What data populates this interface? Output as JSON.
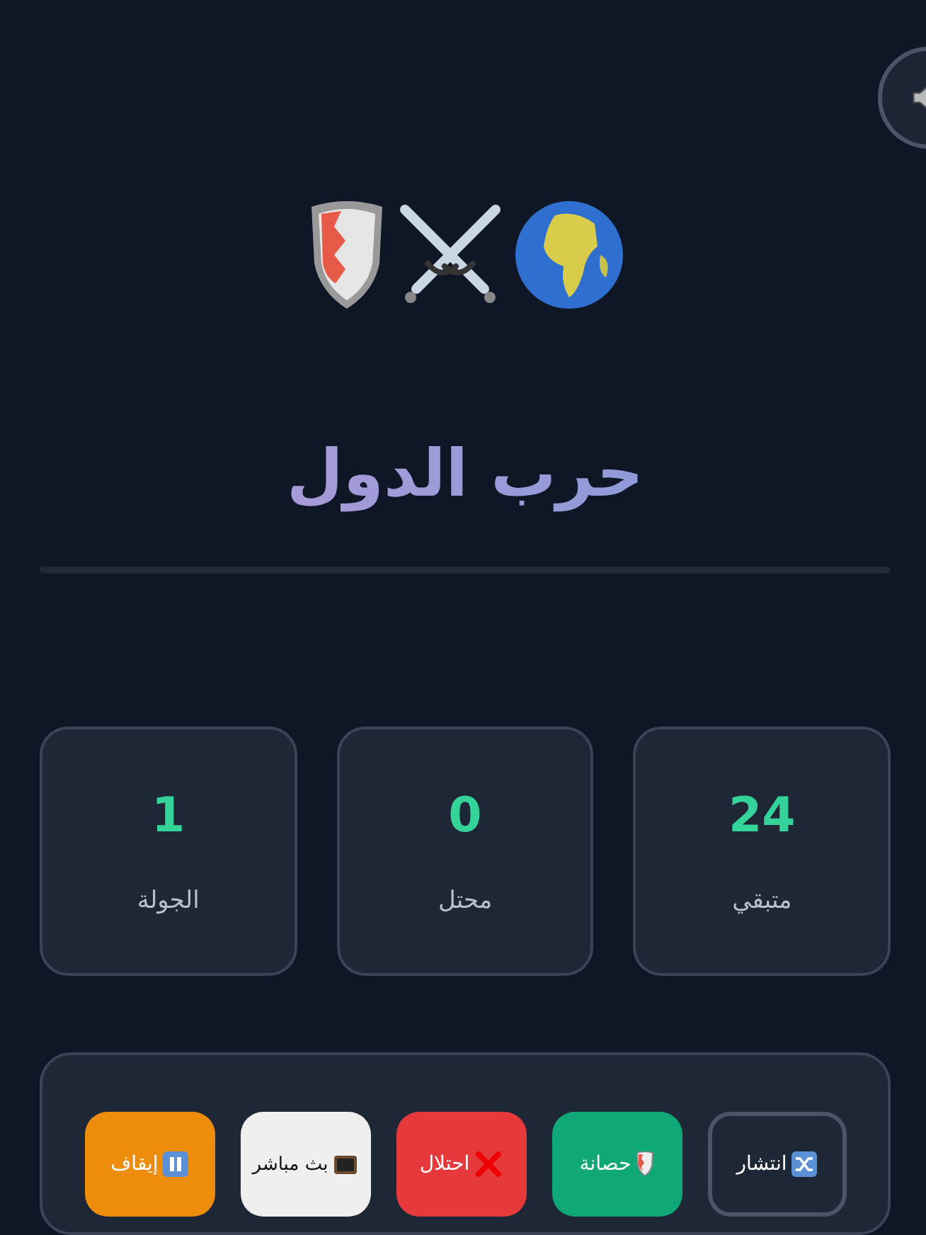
{
  "title": "حرب الدول",
  "progress": {
    "level": 0
  },
  "stats": [
    {
      "value": "24",
      "label": "متبقي"
    },
    {
      "value": "0",
      "label": "محتل"
    },
    {
      "value": "1",
      "label": "الجولة"
    }
  ],
  "controls": [
    {
      "kind": "shuffle",
      "label": "انتشار"
    },
    {
      "kind": "shield",
      "label": "حصانة"
    },
    {
      "kind": "occupy",
      "label": "احتلال"
    },
    {
      "kind": "live",
      "label": "بث مباشر"
    },
    {
      "kind": "pause",
      "label": "إيقاف"
    }
  ]
}
